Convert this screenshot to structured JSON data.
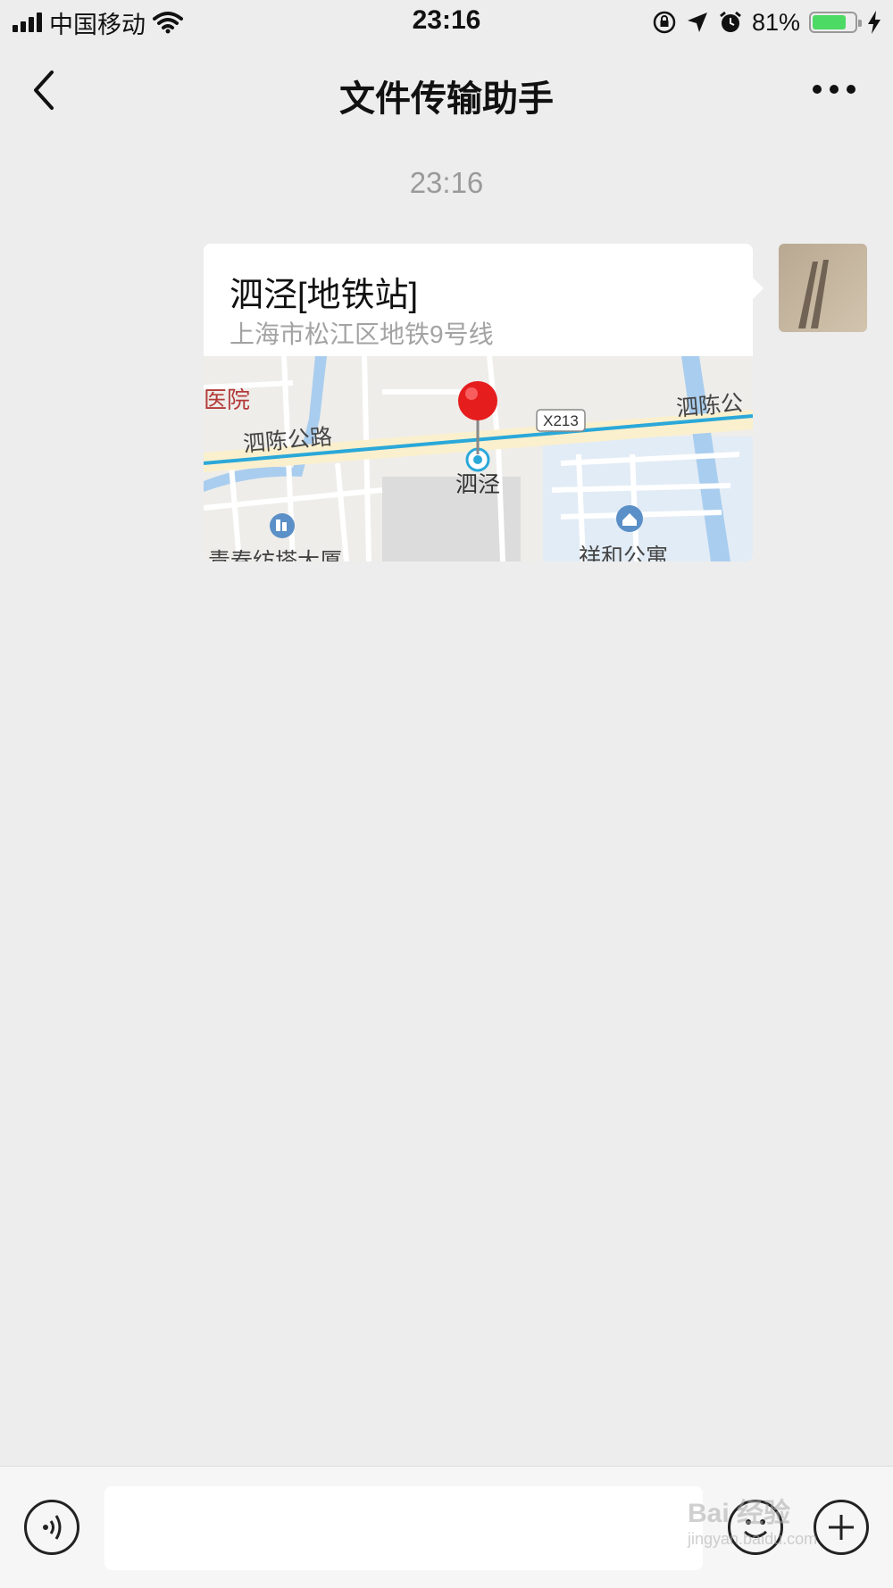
{
  "status_bar": {
    "carrier": "中国移动",
    "time": "23:16",
    "battery": "81%",
    "battery_level": 0.81,
    "battery_color": "#4cd964"
  },
  "nav": {
    "title": "文件传输助手",
    "back_icon": "chevron-left-icon",
    "more_icon": "more-dots-icon"
  },
  "chat": {
    "timestamp": "23:16",
    "messages": [
      {
        "type": "location",
        "title": "泗泾[地铁站]",
        "address": "上海市松江区地铁9号线",
        "map": {
          "road_main": "泗陈公路",
          "road_right": "泗陈公",
          "road_badge": "X213",
          "station": "泗泾",
          "poi_red": "医院",
          "poi_bottom_left": "青春纺塔大厦",
          "poi_bottom_right": "祥和公寓"
        }
      }
    ]
  },
  "input_bar": {
    "placeholder": "",
    "voice_icon": "voice-icon",
    "emoji_icon": "emoji-icon",
    "plus_icon": "plus-icon"
  },
  "watermark": {
    "brand": "Bai 经验",
    "url": "jingyan.baidu.com"
  }
}
